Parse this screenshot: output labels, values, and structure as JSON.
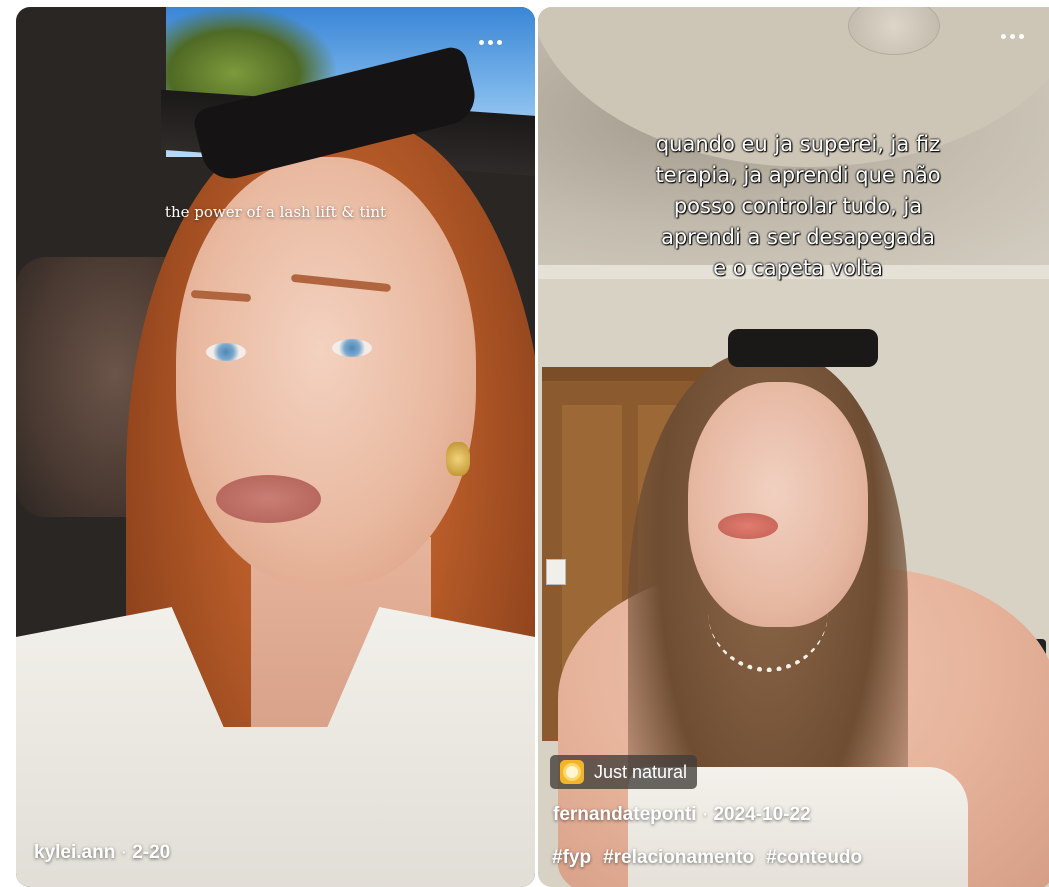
{
  "feed": {
    "cards": [
      {
        "overlay_text": "the power of a lash lift & tint",
        "author": "kylei.ann",
        "separator": " · ",
        "date": "2-20",
        "more_icon": "more-horizontal-icon"
      },
      {
        "overlay_text": "quando eu ja superei, ja fiz terapia, ja aprendi que não posso controlar tudo, ja aprendi a ser desapegada e o capeta volta",
        "overlay_lines": [
          "quando eu ja superei, ja fiz",
          "terapia, ja aprendi que não",
          "posso controlar tudo, ja",
          "aprendi a ser desapegada",
          "e o capeta volta"
        ],
        "badge": {
          "icon": "sparkle-icon",
          "label": "Just natural"
        },
        "author": "fernandateponti",
        "separator": " · ",
        "date": "2024-10-22",
        "tags": [
          "#fyp",
          "#relacionamento",
          "#conteudo"
        ],
        "more_icon": "more-horizontal-icon"
      }
    ]
  },
  "colors": {
    "badge_bg": "#403c38",
    "badge_icon": "#f4b42a",
    "text": "#ffffff"
  }
}
